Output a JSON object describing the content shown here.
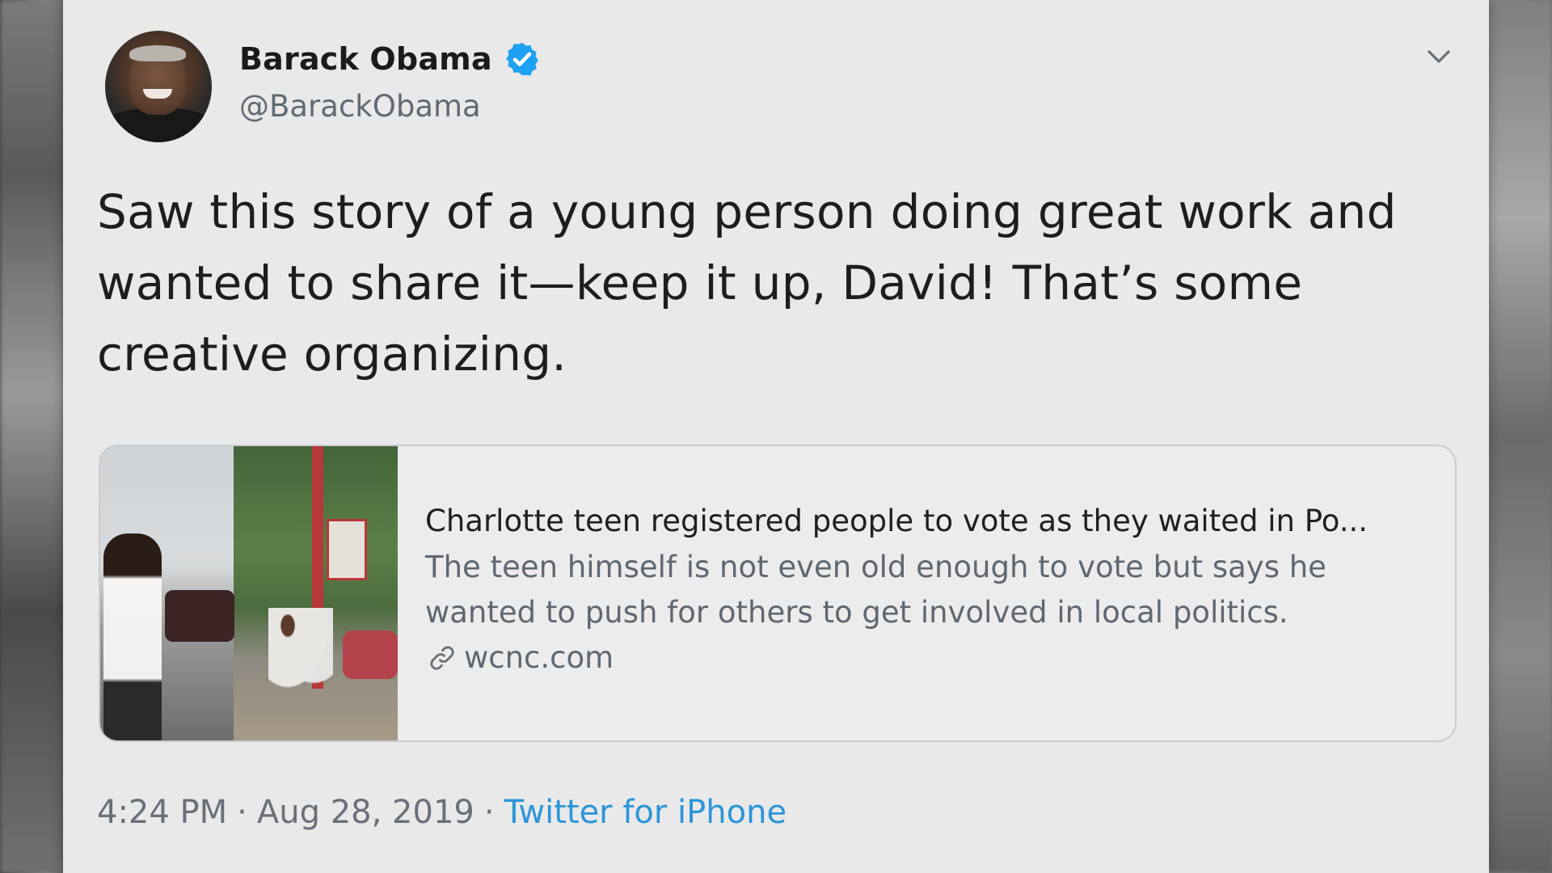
{
  "tweet": {
    "author": {
      "display_name": "Barack Obama",
      "handle": "@BarackObama",
      "verified": true
    },
    "text_lines": [
      "Saw this story of a young person doing great work and",
      "wanted to share it—keep it up, David! That’s some",
      "creative organizing."
    ],
    "link_card": {
      "title": "Charlotte teen registered people to vote as they waited in Po...",
      "description_lines": [
        "The teen himself is not even old enough to vote but says he",
        "wanted to push for others to get involved in local politics."
      ],
      "domain": "wcnc.com"
    },
    "meta": {
      "time": "4:24 PM",
      "separator": "·",
      "date": "Aug 28, 2019",
      "source": "Twitter for iPhone"
    }
  },
  "colors": {
    "card_background": "#e9e9ea",
    "verified_badge": "#1da1f2",
    "source_link": "#2c95d8",
    "secondary_text": "#616a73"
  },
  "icons": {
    "verified": "verified-badge-icon",
    "menu": "chevron-down-icon",
    "link": "link-icon"
  }
}
